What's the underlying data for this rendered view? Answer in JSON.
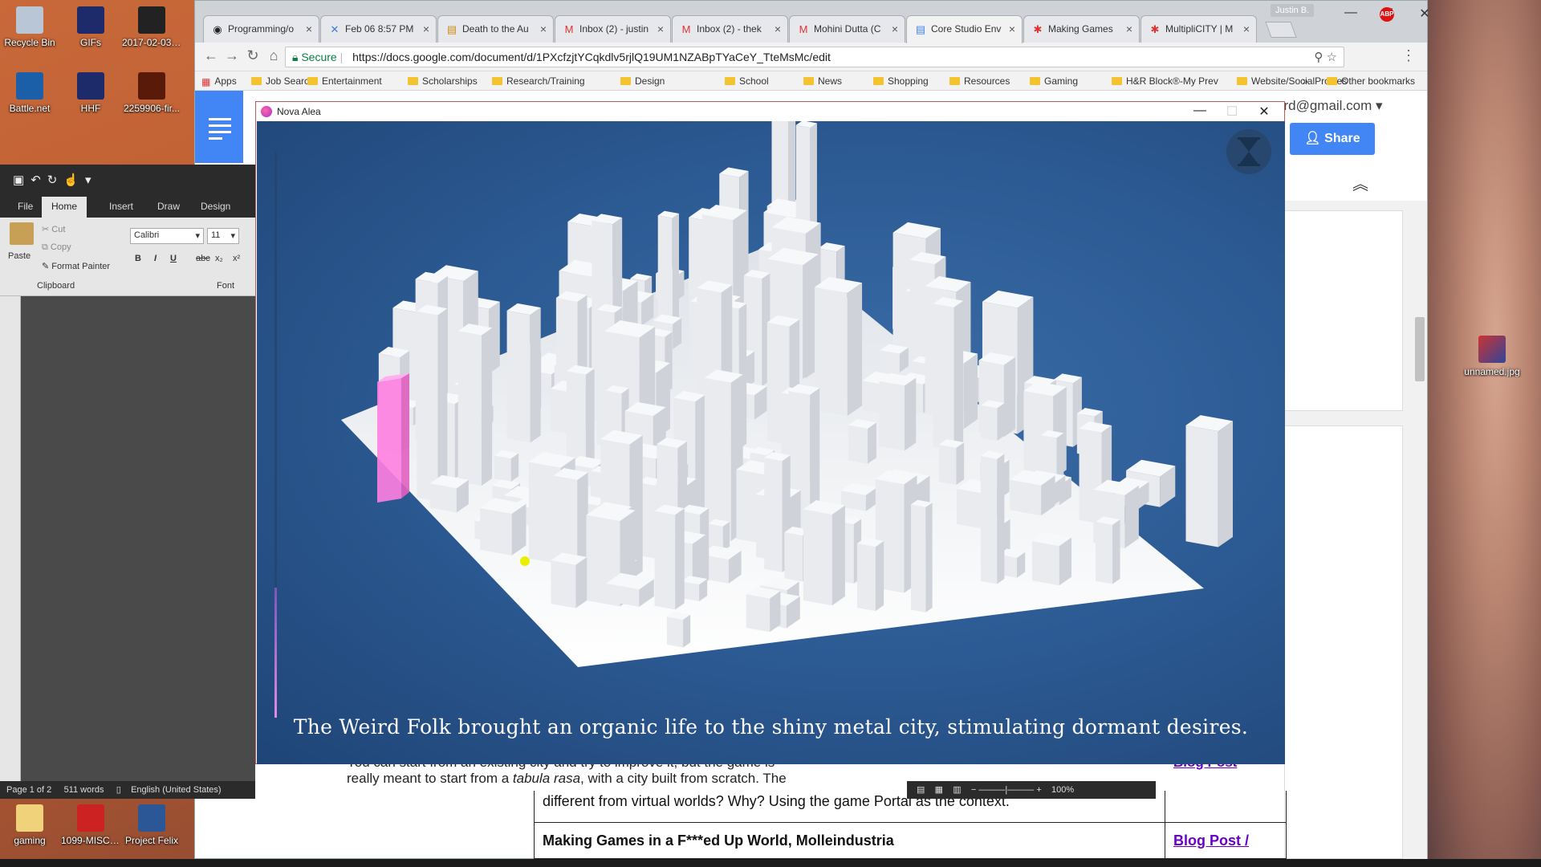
{
  "desktop": {
    "icons_left": [
      {
        "label": "Recycle Bin",
        "icon": "recycle-bin-icon",
        "color": "#b9c6d6"
      },
      {
        "label": "GIFs",
        "icon": "folder-icon",
        "color": "#1d2b6b"
      },
      {
        "label": "2017-02-03 14-52-22...",
        "icon": "video-file-icon",
        "color": "#222222"
      },
      {
        "label": "Battle.net",
        "icon": "battlenet-icon",
        "color": "#1a5fa8"
      },
      {
        "label": "HHF",
        "icon": "folder-icon",
        "color": "#1d2b6b"
      },
      {
        "label": "2259906-fir...",
        "icon": "image-file-icon",
        "color": "#5a1a0a"
      }
    ],
    "icon_right": {
      "label": "unnamed.jpg",
      "icon": "image-file-icon"
    },
    "icons_bottom": [
      {
        "label": "gaming",
        "icon": "folder-icon"
      },
      {
        "label": "1099-MISC_...",
        "icon": "pdf-icon"
      },
      {
        "label": "Project Felix",
        "icon": "app-icon"
      }
    ]
  },
  "chrome": {
    "profile": "Justin B.",
    "tabs": [
      {
        "label": "Programming/o",
        "icon": "github-icon"
      },
      {
        "label": "Feb 06 8:57 PM",
        "icon": "x-icon"
      },
      {
        "label": "Death to the Au",
        "icon": "doc-icon"
      },
      {
        "label": "Inbox (2) - justin",
        "icon": "gmail-icon"
      },
      {
        "label": "Inbox (2) - thek",
        "icon": "gmail-icon"
      },
      {
        "label": "Mohini Dutta (C",
        "icon": "gmail-icon"
      },
      {
        "label": "Core Studio Env",
        "icon": "docs-icon",
        "active": true
      },
      {
        "label": "Making Games",
        "icon": "gear-icon"
      },
      {
        "label": "MultipliCITY | M",
        "icon": "gear-icon"
      }
    ],
    "address": {
      "secure_label": "Secure",
      "url": "https://docs.google.com/document/d/1PXcfzjtYCqkdlv5rjlQ19UM1NZABpTYaCeY_TteMsMc/edit"
    },
    "bookmarks": [
      "Apps",
      "Job Search",
      "Entertainment",
      "Scholarships",
      "Research/Training",
      "Design",
      "School",
      "News",
      "Shopping",
      "Resources",
      "Gaming",
      "H&R Block®-My Prev",
      "Website/SocialProfiles"
    ],
    "bookmarks_overflow": "»",
    "other_bookmarks": "Other bookmarks"
  },
  "docs": {
    "account": "ard@gmail.com",
    "share_label": "Share",
    "table": {
      "row1_text": "different from virtual worlds? Why? Using the game Portal as the context.",
      "row2_title": "Making Games in a F***ed Up World, Molleindustria",
      "row2_link": "Blog Post /",
      "behind_link": "Blog Post"
    },
    "behind_text_1": "You can start from an existing city and try to improve it, but the game is",
    "behind_text_2a": "really meant to start from a ",
    "behind_text_2b": "tabula rasa",
    "behind_text_2c": ", with a city built from scratch. The"
  },
  "word": {
    "tabs": [
      "File",
      "Home",
      "Insert",
      "Draw",
      "Design"
    ],
    "clipboard": {
      "paste": "Paste",
      "cut": "Cut",
      "copy": "Copy",
      "format_painter": "Format Painter",
      "group": "Clipboard"
    },
    "font": {
      "name": "Calibri",
      "size": "11",
      "group": "Font"
    },
    "status": {
      "page": "Page 1 of 2",
      "words": "511 words",
      "language": "English (United States)",
      "zoom": "100%"
    }
  },
  "game": {
    "title": "Nova Alea",
    "caption": "The Weird Folk brought an organic life to the shiny metal city, stimulating dormant desires.",
    "progress": 0.23,
    "colors": {
      "sky": "#2c5a93",
      "highlight_tower": "#ff80e0",
      "marker": "#e8f000"
    }
  }
}
